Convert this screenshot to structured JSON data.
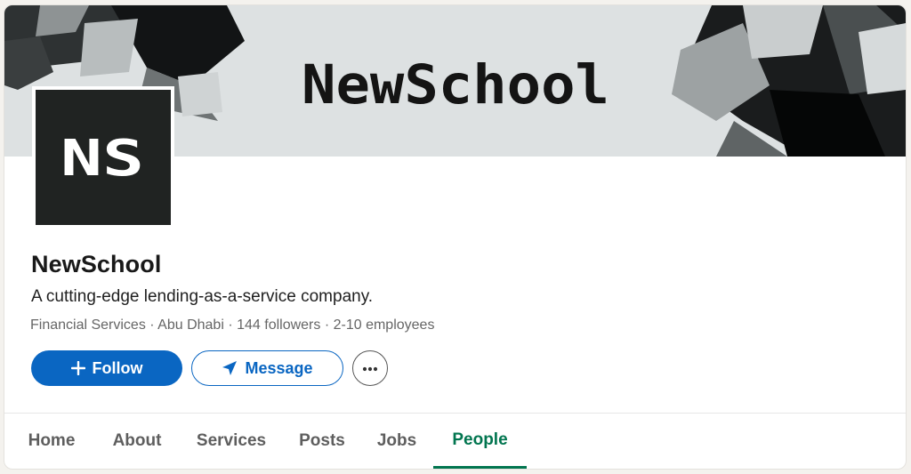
{
  "company": {
    "name": "NewSchool",
    "tagline": "A cutting-edge lending-as-a-service company.",
    "meta": "Financial Services · Abu Dhabi · 144 followers · 2-10 employees",
    "banner_wordmark": "NewSchool",
    "logo_text": "NS"
  },
  "actions": {
    "follow_label": "Follow",
    "message_label": "Message",
    "follow_icon": "plus-icon",
    "message_icon": "paper-plane-icon",
    "more_icon": "ellipsis-icon"
  },
  "tabs": [
    {
      "label": "Home",
      "active": false
    },
    {
      "label": "About",
      "active": false
    },
    {
      "label": "Services",
      "active": false
    },
    {
      "label": "Posts",
      "active": false
    },
    {
      "label": "Jobs",
      "active": false
    },
    {
      "label": "People",
      "active": true
    }
  ],
  "colors": {
    "primary": "#0a66c2",
    "active_tab": "#01754f",
    "logo_bg": "#202322",
    "banner_bg": "#dde1e2"
  }
}
